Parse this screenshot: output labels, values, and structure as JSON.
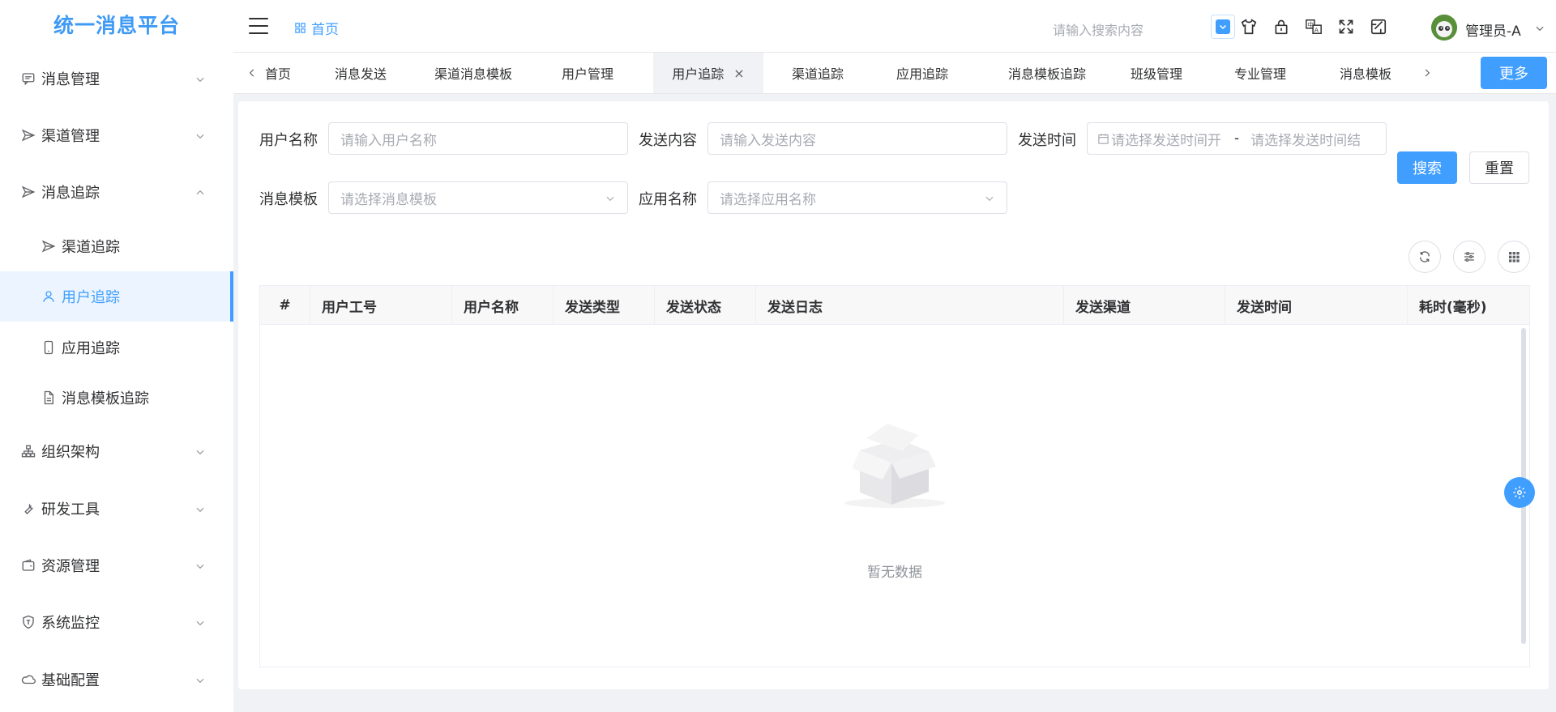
{
  "app": {
    "title": "统一消息平台"
  },
  "sidebar": {
    "menus": [
      {
        "label": "消息管理",
        "icon": "message-icon"
      },
      {
        "label": "渠道管理",
        "icon": "send-icon"
      },
      {
        "label": "消息追踪",
        "icon": "send-icon",
        "expanded": true
      },
      {
        "label": "组织架构",
        "icon": "org-chart-icon"
      },
      {
        "label": "研发工具",
        "icon": "wrench-icon"
      },
      {
        "label": "资源管理",
        "icon": "wallet-icon"
      },
      {
        "label": "系统监控",
        "icon": "shield-icon"
      },
      {
        "label": "基础配置",
        "icon": "cloud-icon"
      }
    ],
    "submenus": [
      {
        "label": "渠道追踪",
        "icon": "send-icon"
      },
      {
        "label": "用户追踪",
        "icon": "user-icon",
        "active": true
      },
      {
        "label": "应用追踪",
        "icon": "phone-icon"
      },
      {
        "label": "消息模板追踪",
        "icon": "document-icon"
      }
    ]
  },
  "header": {
    "breadcrumb": "首页",
    "search_placeholder": "请输入搜索内容",
    "user_name": "管理员-A"
  },
  "tabs": {
    "items": [
      {
        "label": "首页"
      },
      {
        "label": "消息发送"
      },
      {
        "label": "渠道消息模板"
      },
      {
        "label": "用户管理"
      },
      {
        "label": "用户追踪",
        "active": true,
        "close": "×"
      },
      {
        "label": "渠道追踪"
      },
      {
        "label": "应用追踪"
      },
      {
        "label": "消息模板追踪"
      },
      {
        "label": "班级管理"
      },
      {
        "label": "专业管理"
      },
      {
        "label": "消息模板"
      }
    ],
    "more_label": "更多"
  },
  "filters": {
    "user_name": {
      "label": "用户名称",
      "placeholder": "请输入用户名称"
    },
    "content": {
      "label": "发送内容",
      "placeholder": "请输入发送内容"
    },
    "time": {
      "label": "发送时间",
      "start_placeholder": "请选择发送时间开",
      "separator": "-",
      "end_placeholder": "请选择发送时间结"
    },
    "template": {
      "label": "消息模板",
      "placeholder": "请选择消息模板"
    },
    "app_name": {
      "label": "应用名称",
      "placeholder": "请选择应用名称"
    },
    "search_label": "搜索",
    "reset_label": "重置"
  },
  "table": {
    "columns": [
      "#",
      "用户工号",
      "用户名称",
      "发送类型",
      "发送状态",
      "发送日志",
      "发送渠道",
      "发送时间",
      "耗时(毫秒)"
    ],
    "rows": [],
    "empty_text": "暂无数据"
  },
  "colors": {
    "accent": "#409eff",
    "logo": "#3f9af5"
  }
}
